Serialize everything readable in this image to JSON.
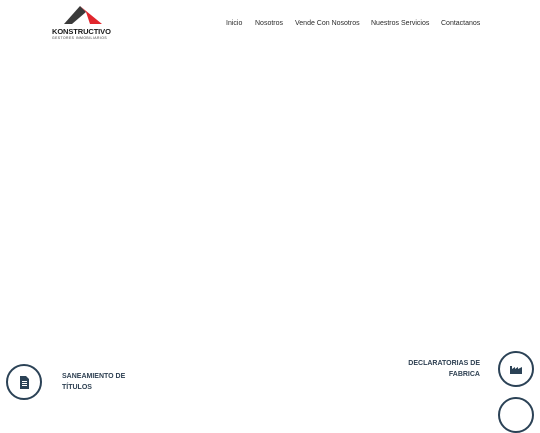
{
  "brand": {
    "name": "KONSTRUCTIVO",
    "tagline": "GESTORES INMOBILIARIOS",
    "colors": {
      "roof_dark": "#3a3a3a",
      "roof_red": "#e1262d"
    }
  },
  "nav": {
    "items": [
      {
        "label": "Inicio"
      },
      {
        "label": "Nosotros"
      },
      {
        "label": "Vende Con Nosotros"
      },
      {
        "label": "Nuestros Servicios"
      },
      {
        "label": "Contactanos"
      }
    ]
  },
  "services": [
    {
      "label_line1": "SANEAMIENTO DE",
      "label_line2": "TÍTULOS",
      "icon": "document-icon"
    },
    {
      "label_line1": "DECLARATORIAS DE",
      "label_line2": "FABRICA",
      "icon": "factory-icon"
    }
  ],
  "theme": {
    "icon_border": "#2b4256",
    "text": "#2e4052"
  }
}
